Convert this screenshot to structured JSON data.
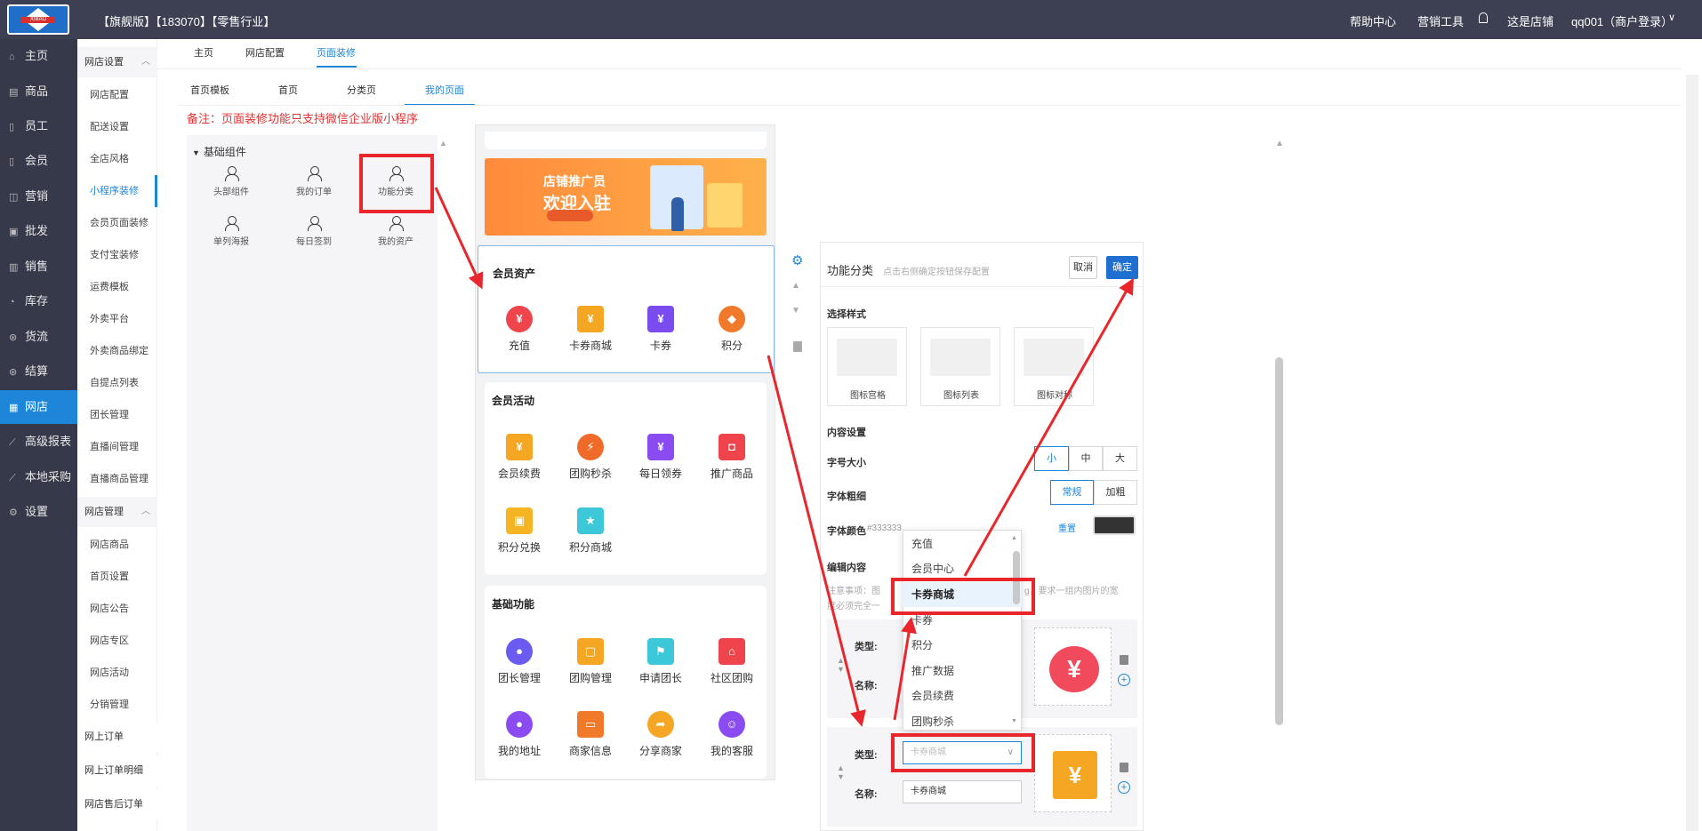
{
  "topbar": {
    "logo_text": "XIBAO",
    "brand": "【旗舰版】【183070】【零售行业】",
    "help": "帮助中心",
    "marketing": "营销工具",
    "store": "这是店铺",
    "user": "qq001（商户登录）",
    "icons": [
      "bell-icon",
      "chevron-down-icon"
    ]
  },
  "leftnav": [
    {
      "label": "主页",
      "icon": "home-icon"
    },
    {
      "label": "商品",
      "icon": "goods-icon"
    },
    {
      "label": "员工",
      "icon": "staff-icon"
    },
    {
      "label": "会员",
      "icon": "member-icon"
    },
    {
      "label": "营销",
      "icon": "marketing-icon"
    },
    {
      "label": "批发",
      "icon": "wholesale-icon"
    },
    {
      "label": "销售",
      "icon": "sales-icon"
    },
    {
      "label": "库存",
      "icon": "stock-icon"
    },
    {
      "label": "货流",
      "icon": "logistics-icon"
    },
    {
      "label": "结算",
      "icon": "settle-icon"
    },
    {
      "label": "网店",
      "icon": "shop-icon"
    },
    {
      "label": "高级报表",
      "icon": "report-icon"
    },
    {
      "label": "本地采购",
      "icon": "purchase-icon"
    },
    {
      "label": "设置",
      "icon": "settings-icon"
    }
  ],
  "subnav": {
    "group1": "网店设置",
    "items1": [
      "网店配置",
      "配送设置",
      "全店风格",
      "小程序装修",
      "会员页面装修",
      "支付宝装修",
      "运费模板",
      "外卖平台",
      "外卖商品绑定",
      "自提点列表",
      "团长管理",
      "直播间管理",
      "直播商品管理"
    ],
    "group2": "网店管理",
    "items2": [
      "网店商品",
      "首页设置",
      "网店公告",
      "网店专区",
      "网店活动",
      "分销管理"
    ],
    "items3": [
      "网上订单",
      "网上订单明细",
      "网店售后订单"
    ]
  },
  "tabs1": [
    "主页",
    "网店配置",
    "页面装修"
  ],
  "tabs2": [
    "首页模板",
    "首页",
    "分类页",
    "我的页面"
  ],
  "notice": "备注：页面装修功能只支持微信企业版小程序",
  "components": {
    "header": "基础组件",
    "items": [
      "头部组件",
      "我的订单",
      "功能分类",
      "单列海报",
      "每日签到",
      "我的资产"
    ]
  },
  "banner": {
    "line1": "店铺推广员",
    "line2": "欢迎入驻"
  },
  "cards": [
    {
      "title": "会员资产",
      "items": [
        "充值",
        "卡券商城",
        "卡券",
        "积分"
      ]
    },
    {
      "title": "会员活动",
      "items": [
        "会员续费",
        "团购秒杀",
        "每日领券",
        "推广商品",
        "积分兑换",
        "积分商城"
      ]
    },
    {
      "title": "基础功能",
      "items": [
        "团长管理",
        "团购管理",
        "申请团长",
        "社区团购",
        "我的地址",
        "商家信息",
        "分享商家",
        "我的客服"
      ]
    }
  ],
  "props": {
    "title": "功能分类",
    "hint": "点击右侧确定按钮保存配置",
    "cancel": "取消",
    "ok": "确定",
    "style_label": "选择样式",
    "styles": [
      "图标宫格",
      "图标列表",
      "图标对称"
    ],
    "content_label": "内容设置",
    "font_size_label": "字号大小",
    "font_sizes": [
      "小",
      "中",
      "大"
    ],
    "font_weight_label": "字体粗细",
    "font_weights": [
      "常规",
      "加粗"
    ],
    "font_color_label": "字体颜色",
    "font_color_value": "#333333",
    "reset": "重置",
    "edit_label": "编辑内容",
    "note_prefix": "注意事项：图",
    "note_suffix": "g，要求一组内图片的宽",
    "note_line2": "度必须完全一",
    "type_label": "类型:",
    "name_label": "名称:",
    "row2_type_value": "卡券商城",
    "row2_name_value": "卡券商城"
  },
  "dropdown": [
    "充值",
    "会员中心",
    "卡券商城",
    "卡券",
    "积分",
    "推广数据",
    "会员续费",
    "团购秒杀"
  ],
  "colors": {
    "accent": "#1e86d8",
    "topbar": "#3d4052",
    "sidebar": "#363949",
    "highlight": "#e8262b",
    "notice": "#e43030"
  }
}
